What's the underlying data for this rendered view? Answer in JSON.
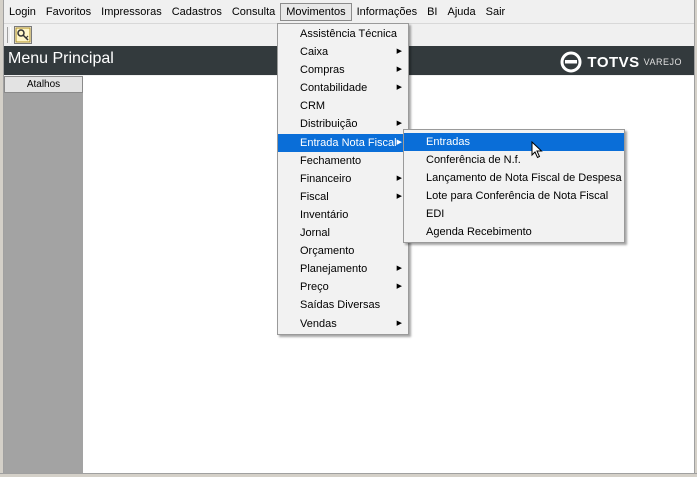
{
  "menubar": {
    "items": [
      "Login",
      "Favoritos",
      "Impressoras",
      "Cadastros",
      "Consulta",
      "Movimentos",
      "Informações",
      "BI",
      "Ajuda",
      "Sair"
    ]
  },
  "header": {
    "title": "Menu Principal"
  },
  "logo": {
    "brand": "TOTVS",
    "sub": "VAREJO"
  },
  "sidebar": {
    "atalhos": "Atalhos"
  },
  "movimentos_menu": {
    "items": [
      {
        "label": "Assistência Técnica",
        "submenu": false
      },
      {
        "label": "Caixa",
        "submenu": true
      },
      {
        "label": "Compras",
        "submenu": true
      },
      {
        "label": "Contabilidade",
        "submenu": true
      },
      {
        "label": "CRM",
        "submenu": false
      },
      {
        "label": "Distribuição",
        "submenu": true
      },
      {
        "label": "Entrada Nota Fiscal",
        "submenu": true,
        "selected": true
      },
      {
        "label": "Fechamento",
        "submenu": false
      },
      {
        "label": "Financeiro",
        "submenu": true
      },
      {
        "label": "Fiscal",
        "submenu": true
      },
      {
        "label": "Inventário",
        "submenu": false
      },
      {
        "label": "Jornal",
        "submenu": false
      },
      {
        "label": "Orçamento",
        "submenu": false
      },
      {
        "label": "Planejamento",
        "submenu": true
      },
      {
        "label": "Preço",
        "submenu": true
      },
      {
        "label": "Saídas Diversas",
        "submenu": false
      },
      {
        "label": "Vendas",
        "submenu": true
      }
    ]
  },
  "entrada_menu": {
    "items": [
      {
        "label": "Entradas",
        "selected": true
      },
      {
        "label": "Conferência de N.f."
      },
      {
        "label": "Lançamento de Nota Fiscal de Despesa"
      },
      {
        "label": "Lote para Conferência de Nota Fiscal"
      },
      {
        "label": "EDI"
      },
      {
        "label": "Agenda Recebimento"
      }
    ]
  },
  "colors": {
    "header_bg": "#333a3d",
    "selection": "#0a6ed8",
    "sidebar": "#a3a3a3"
  },
  "icons": {
    "toolbar_button": "key-icon",
    "submenu_arrow": "arrow-right-icon",
    "logo": "totvs-logo-icon",
    "cursor": "mouse-pointer-icon"
  }
}
